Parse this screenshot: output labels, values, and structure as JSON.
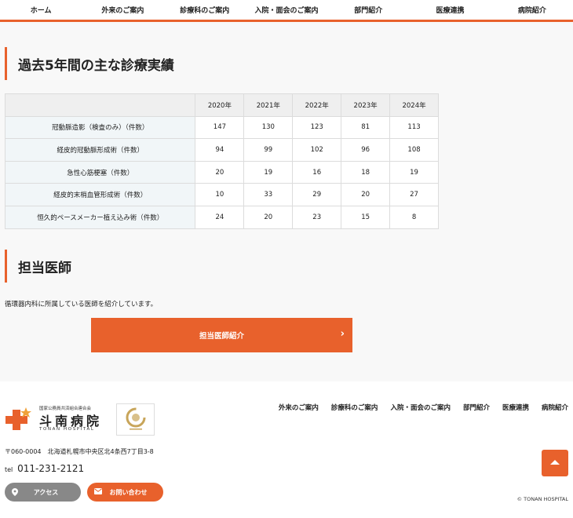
{
  "top_nav": {
    "items": [
      "ホーム",
      "外来のご案内",
      "診療科のご案内",
      "入院・面会のご案内",
      "部門紹介",
      "医療連携",
      "病院紹介"
    ]
  },
  "performance": {
    "title": "過去5年間の主な診療実績",
    "years": [
      "2020年",
      "2021年",
      "2022年",
      "2023年",
      "2024年"
    ],
    "rows": [
      {
        "label": "冠動脈造影（検査のみ）（件数）",
        "values": [
          "147",
          "130",
          "123",
          "81",
          "113"
        ]
      },
      {
        "label": "経皮的冠動脈形成術（件数）",
        "values": [
          "94",
          "99",
          "102",
          "96",
          "108"
        ]
      },
      {
        "label": "急性心筋梗塞（件数）",
        "values": [
          "20",
          "19",
          "16",
          "18",
          "19"
        ]
      },
      {
        "label": "経皮的末梢血管形成術（件数）",
        "values": [
          "10",
          "33",
          "29",
          "20",
          "27"
        ]
      },
      {
        "label": "恒久的ペースメーカー植え込み術（件数）",
        "values": [
          "24",
          "20",
          "23",
          "15",
          "8"
        ]
      }
    ]
  },
  "doctors": {
    "title": "担当医師",
    "description": "循環器内科に所属している医師を紹介しています。",
    "button_label": "担当医師紹介",
    "button_icon": "chevron-right-icon"
  },
  "footer": {
    "logo": {
      "org": "国家公務員共済組合連合会",
      "name": "斗南病院",
      "en": "TONAN HOSPITAL"
    },
    "nav": [
      "外来のご案内",
      "診療科のご案内",
      "入院・面会のご案内",
      "部門紹介",
      "医療連携",
      "病院紹介"
    ],
    "address": "〒060-0004　北海道札幌市中央区北4条西7丁目3-8",
    "tel_label": "tel",
    "tel": "011-231-2121",
    "access_label": "アクセス",
    "contact_label": "お問い合わせ",
    "copyright": "© TONAN HOSPITAL"
  },
  "colors": {
    "accent": "#e8612c",
    "access_button": "#888888",
    "row_header_bg": "#f1f6f8"
  }
}
